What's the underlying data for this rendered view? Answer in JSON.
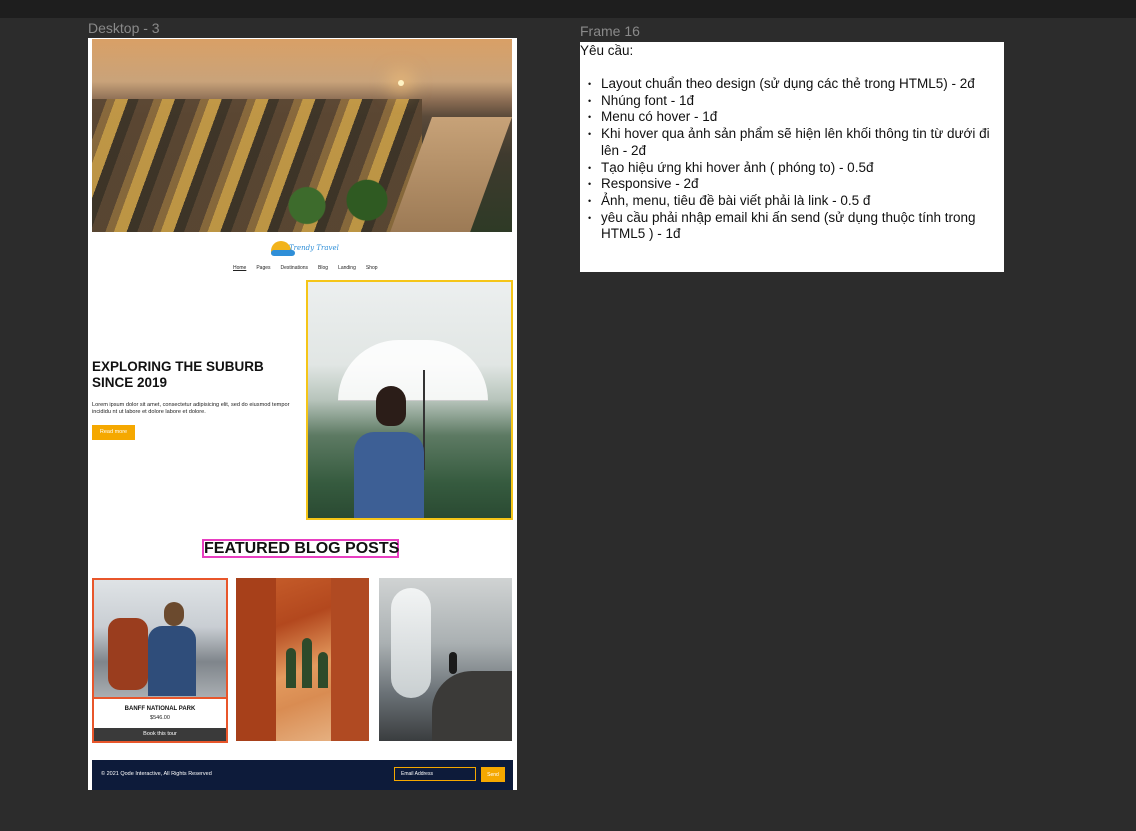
{
  "canvas": {
    "desktop_label": "Desktop - 3",
    "frame_label": "Frame 16"
  },
  "site": {
    "logo_text": "Trendy Travel",
    "nav": [
      {
        "label": "Home",
        "active": true
      },
      {
        "label": "Pages"
      },
      {
        "label": "Destinations"
      },
      {
        "label": "Blog"
      },
      {
        "label": "Landing"
      },
      {
        "label": "Shop"
      }
    ],
    "hero_heading": "EXPLORING THE SUBURB SINCE 2019",
    "hero_text": "Lorem ipsum dolor sit amet, consectetur adipisicing elit, sed do eiusmod tempor incididu nt ut labore et dolore labore et dolore.",
    "read_more": "Read more",
    "featured_title": "FEATURED BLOG POSTS",
    "card": {
      "title": "BANFF NATIONAL PARK",
      "price": "$546.00",
      "book": "Book this tour"
    },
    "footer": {
      "copyright": "© 2021 Qode Interactive, All Rights Reserved",
      "email_placeholder": "Email Address",
      "send": "Send"
    }
  },
  "requirements": {
    "title": "Yêu cầu:",
    "items": [
      "Layout chuẩn theo design (sử dụng các  thẻ trong HTML5) - 2đ",
      "Nhúng font - 1đ",
      "Menu có hover - 1đ",
      "Khi hover qua ảnh sản phẩm sẽ hiện lên khối thông tin từ dưới đi lên  - 2đ",
      "Tạo hiệu ứng khi hover ảnh ( phóng to) - 0.5đ",
      "Responsive - 2đ",
      "Ảnh, menu, tiêu đề bài viết phải là link - 0.5 đ",
      "yêu cầu phải nhập email khi ấn send (sử dụng thuộc tính trong HTML5 ) - 1đ"
    ]
  }
}
